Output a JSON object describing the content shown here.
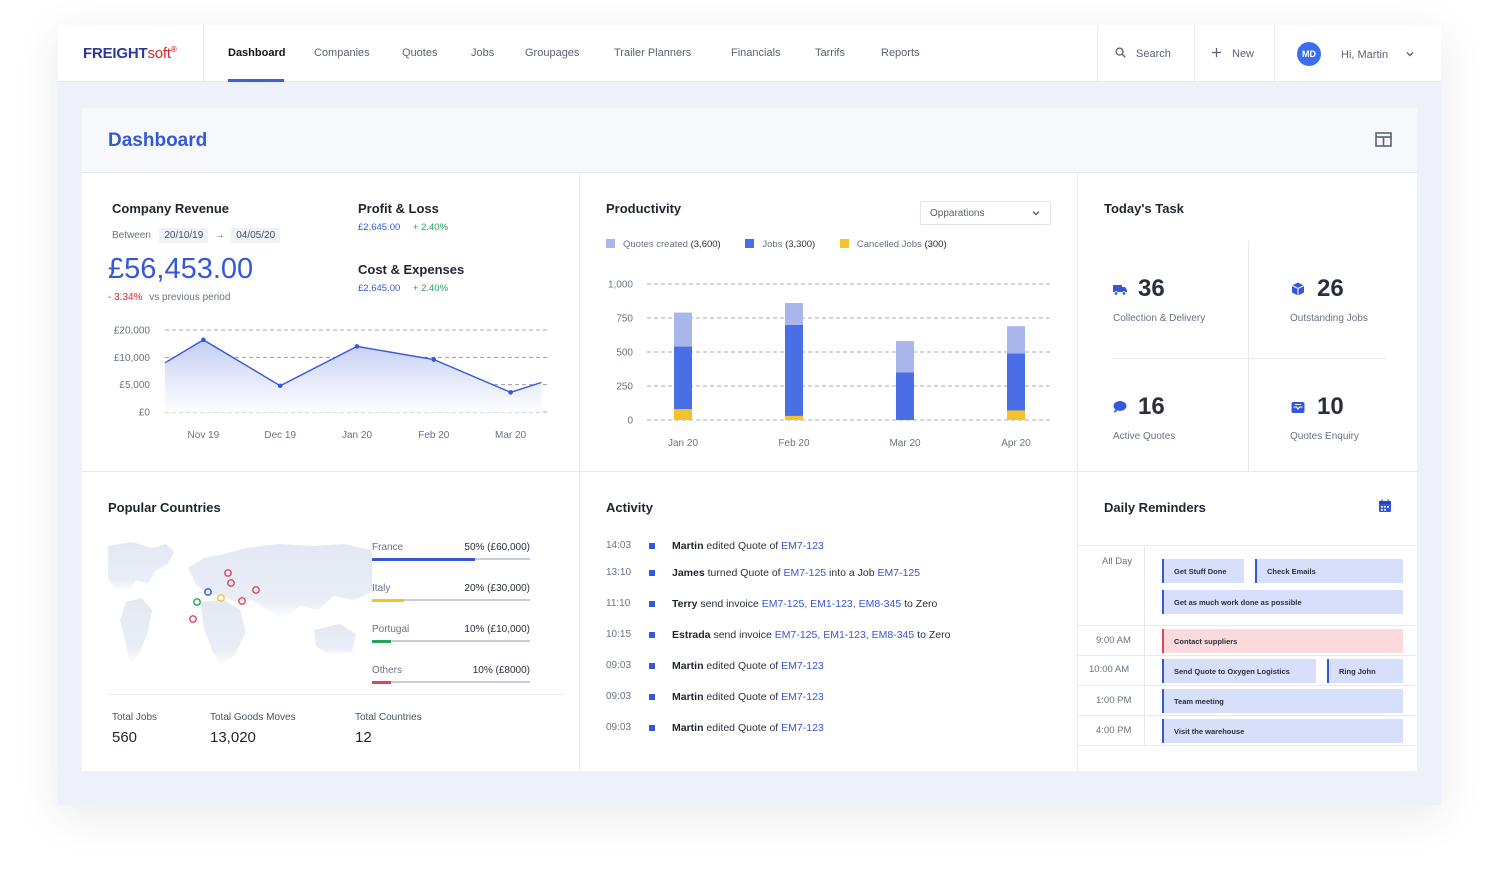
{
  "brand": {
    "name_main": "FREIGHT",
    "name_soft": "soft",
    "mark": "®"
  },
  "nav": {
    "items": [
      {
        "label": "Dashboard",
        "active": true
      },
      {
        "label": "Companies"
      },
      {
        "label": "Quotes"
      },
      {
        "label": "Jobs"
      },
      {
        "label": "Groupages"
      },
      {
        "label": "Trailer Planners"
      },
      {
        "label": "Financials"
      },
      {
        "label": "Tarrifs"
      },
      {
        "label": "Reports"
      }
    ],
    "search_label": "Search",
    "new_label": "New",
    "user_initials": "MD",
    "user_greeting": "Hi, Martin"
  },
  "page_title": "Dashboard",
  "revenue": {
    "title": "Company Revenue",
    "between_label": "Between",
    "from_date": "20/10/19",
    "to_date": "04/05/20",
    "amount": "£56,453.00",
    "change": "- 3.34%",
    "change_note": "vs previous period",
    "profit_title": "Profit & Loss",
    "profit_amount": "£2,645.00",
    "profit_change": "+ 2.40%",
    "cost_title": "Cost & Expenses",
    "cost_amount": "£2,645.00",
    "cost_change": "+ 2.40%"
  },
  "productivity": {
    "title": "Productivity",
    "select_value": "Opparations",
    "legend": [
      {
        "label": "Quotes created",
        "count": "(3,600)",
        "color": "#a9b6ec"
      },
      {
        "label": "Jobs",
        "count": "(3,300)",
        "color": "#4a6ee6"
      },
      {
        "label": "Cancelled Jobs",
        "count": "(300)",
        "color": "#f5c22c"
      }
    ]
  },
  "chart_data": [
    {
      "type": "area",
      "title": "Company Revenue",
      "categories": [
        "Nov 19",
        "Dec 19",
        "Jan 20",
        "Feb 20",
        "Mar 20"
      ],
      "y_ticks": [
        "£20,000",
        "£10,000",
        "£5,000",
        "£0"
      ],
      "x": [
        0,
        0.5,
        1.5,
        2.5,
        3.5,
        4.5,
        4.9
      ],
      "values": [
        15,
        22,
        8,
        20,
        16,
        6,
        9
      ],
      "ylim": [
        0,
        25
      ],
      "grid": true
    },
    {
      "type": "bar",
      "title": "Productivity",
      "stacked": true,
      "categories": [
        "Jan 20",
        "Feb 20",
        "Mar 20",
        "Apr 20"
      ],
      "y_ticks": [
        "1,000",
        "750",
        "500",
        "250",
        "0"
      ],
      "ylim": [
        0,
        1000
      ],
      "series": [
        {
          "name": "Cancelled Jobs",
          "values": [
            80,
            30,
            0,
            70
          ],
          "color": "#f5c22c"
        },
        {
          "name": "Jobs",
          "values": [
            460,
            670,
            350,
            420
          ],
          "color": "#4a6ee6"
        },
        {
          "name": "Quotes created",
          "values": [
            250,
            160,
            230,
            200
          ],
          "color": "#a9b6ec"
        }
      ],
      "grid": true
    }
  ],
  "tasks": {
    "title": "Today's Task",
    "items": [
      {
        "value": "36",
        "label": "Collection & Delivery",
        "icon": "truck-icon"
      },
      {
        "value": "26",
        "label": "Outstanding Jobs",
        "icon": "box-icon"
      },
      {
        "value": "16",
        "label": "Active Quotes",
        "icon": "chat-icon"
      },
      {
        "value": "10",
        "label": "Quotes Enquiry",
        "icon": "inbox-icon"
      }
    ]
  },
  "countries": {
    "title": "Popular Countries",
    "items": [
      {
        "name": "France",
        "value": "50% (£60,000)",
        "percent": 0.65,
        "color": "#3558d8"
      },
      {
        "name": "Italy",
        "value": "20% (£30,000)",
        "percent": 0.2,
        "color": "#f5c22c"
      },
      {
        "name": "Portugal",
        "value": "10% (£10,000)",
        "percent": 0.12,
        "color": "#21a55b"
      },
      {
        "name": "Others",
        "value": "10% (£8000)",
        "percent": 0.12,
        "color": "#e04455"
      }
    ],
    "stats": [
      {
        "label": "Total Jobs",
        "value": "560"
      },
      {
        "label": "Total Goods Moves",
        "value": "13,020"
      },
      {
        "label": "Total  Countries",
        "value": "12"
      }
    ]
  },
  "activity": {
    "title": "Activity",
    "rows": [
      {
        "time": "14:03",
        "user": "Martin",
        "action": " edited Quote of ",
        "ref1": "EM7-123",
        "mid": "",
        "ref2": "",
        "tail": ""
      },
      {
        "time": "13:10",
        "user": "James",
        "action": " turned Quote of ",
        "ref1": "EM7-125",
        "mid": " into a Job ",
        "ref2": "EM7-125",
        "tail": ""
      },
      {
        "time": "11:10",
        "user": "Terry",
        "action": " send invoice ",
        "ref1": "EM7-125, EM1-123, EM8-345",
        "mid": "",
        "ref2": "",
        "tail": " to Zero"
      },
      {
        "time": "10:15",
        "user": "Estrada",
        "action": " send invoice ",
        "ref1": "EM7-125, EM1-123, EM8-345",
        "mid": "",
        "ref2": "",
        "tail": " to Zero"
      },
      {
        "time": "09:03",
        "user": "Martin",
        "action": " edited Quote of ",
        "ref1": "EM7-123",
        "mid": "",
        "ref2": "",
        "tail": ""
      },
      {
        "time": "09:03",
        "user": "Martin",
        "action": " edited Quote of ",
        "ref1": "EM7-123",
        "mid": "",
        "ref2": "",
        "tail": ""
      },
      {
        "time": "09:03",
        "user": "Martin",
        "action": " edited Quote of ",
        "ref1": "EM7-123",
        "mid": "",
        "ref2": "",
        "tail": ""
      }
    ]
  },
  "reminders": {
    "title": "Daily Reminders",
    "times": [
      "All Day",
      "9:00 AM",
      "10:00 AM",
      "1:00 PM",
      "4:00 PM"
    ],
    "events": [
      {
        "label": "Get Stuff Done",
        "kind": "blue"
      },
      {
        "label": "Check Emails",
        "kind": "blue"
      },
      {
        "label": "Get as much work done as possible",
        "kind": "blue"
      },
      {
        "label": "Contact suppliers",
        "kind": "red"
      },
      {
        "label": "Send Quote to Oxygen Logistics",
        "kind": "blue"
      },
      {
        "label": "Ring John",
        "kind": "blue"
      },
      {
        "label": "Team meeting",
        "kind": "blue"
      },
      {
        "label": "Visit the warehouse",
        "kind": "blue"
      }
    ]
  }
}
